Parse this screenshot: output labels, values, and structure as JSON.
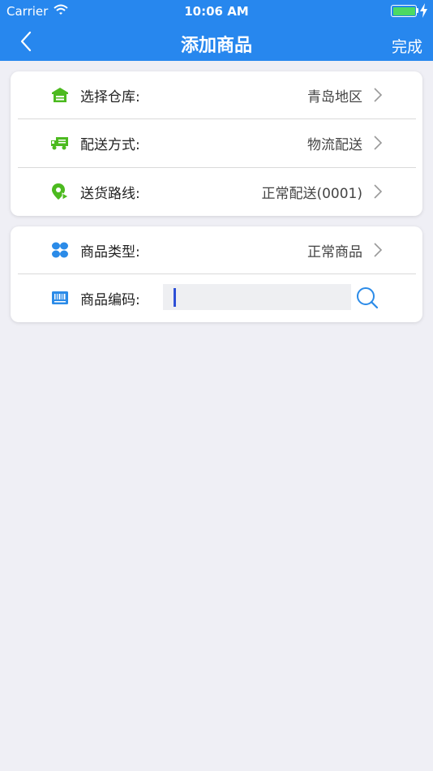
{
  "status_bar": {
    "carrier": "Carrier",
    "time": "10:06 AM",
    "battery_level": 1.0
  },
  "nav": {
    "title": "添加商品",
    "done_label": "完成"
  },
  "colors": {
    "header_blue": "#2787ee",
    "icon_green": "#4cba1f",
    "icon_blue": "#2b8be8",
    "background": "#efeff5"
  },
  "card1": {
    "rows": [
      {
        "label": "选择仓库:",
        "value": "青岛地区",
        "icon": "warehouse-icon"
      },
      {
        "label": "配送方式:",
        "value": "物流配送",
        "icon": "truck-icon"
      },
      {
        "label": "送货路线:",
        "value": "正常配送(0001)",
        "icon": "location-pin-icon"
      }
    ]
  },
  "card2": {
    "type_row": {
      "label": "商品类型:",
      "value": "正常商品",
      "icon": "clover-grid-icon"
    },
    "code_row": {
      "label": "商品编码:",
      "input_value": "",
      "icon": "barcode-icon"
    }
  }
}
